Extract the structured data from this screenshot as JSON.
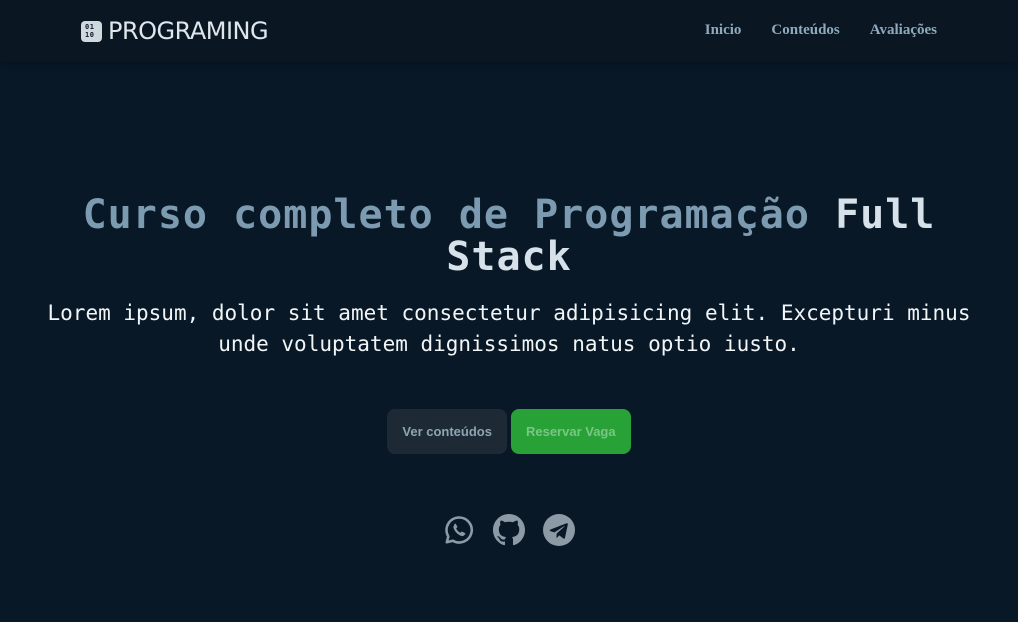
{
  "brand": {
    "logo_top": "01",
    "logo_bottom": "10",
    "name": "PROGRAMING"
  },
  "nav": {
    "items": [
      {
        "label": "Inicio"
      },
      {
        "label": "Conteúdos"
      },
      {
        "label": "Avaliações"
      }
    ]
  },
  "hero": {
    "title_main": "Curso completo de Programação ",
    "title_accent": "Full Stack",
    "subtitle": "Lorem ipsum, dolor sit amet consectetur adipisicing elit. Excepturi minus unde voluptatem dignissimos natus optio iusto."
  },
  "buttons": {
    "secondary_label": "Ver conteúdos",
    "primary_label": "Reservar Vaga"
  },
  "social": {
    "icons": [
      "whatsapp-icon",
      "github-icon",
      "telegram-icon"
    ]
  },
  "colors": {
    "background": "#081826",
    "navbar": "#0a1722",
    "title": "#7c9bb1",
    "title_accent": "#d6e1ea",
    "primary_button": "#28a136",
    "secondary_button": "#1d2a36",
    "icons": "#8c9aa6"
  }
}
